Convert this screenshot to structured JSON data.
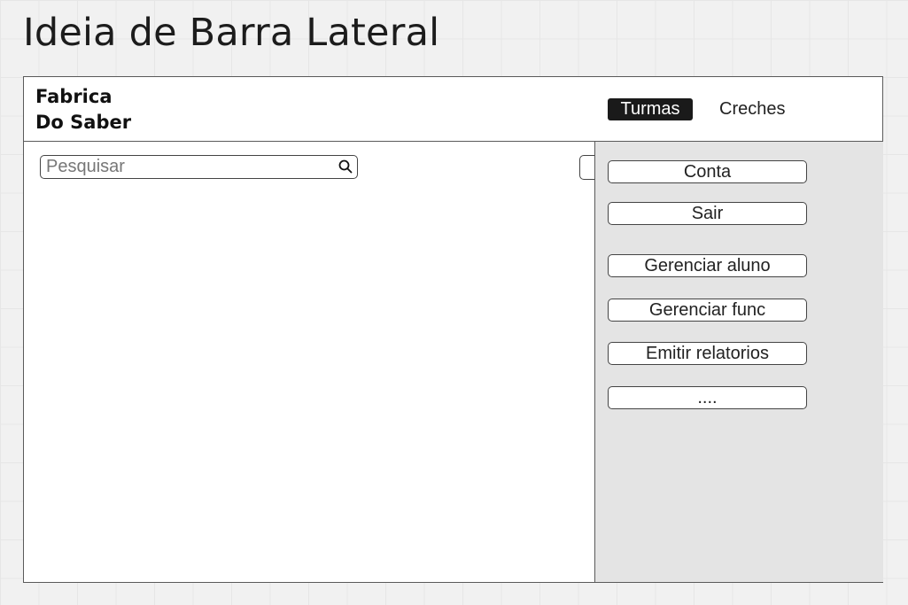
{
  "page": {
    "heading": "Ideia de Barra Lateral"
  },
  "header": {
    "brand_line1": "Fabrica",
    "brand_line2": "Do Saber",
    "tabs": [
      {
        "label": "Turmas",
        "active": true
      },
      {
        "label": "Creches",
        "active": false
      }
    ]
  },
  "search": {
    "placeholder": "Pesquisar",
    "value": ""
  },
  "sidebar": {
    "items": [
      {
        "label": "Conta"
      },
      {
        "label": "Sair"
      },
      {
        "label": "Gerenciar aluno"
      },
      {
        "label": "Gerenciar func"
      },
      {
        "label": "Emitir relatorios"
      },
      {
        "label": "...."
      }
    ]
  },
  "colors": {
    "background": "#f1f1f1",
    "sidebar_bg": "#e4e4e4",
    "active_tab_bg": "#1a1a1a",
    "border": "#5a5a5a"
  }
}
